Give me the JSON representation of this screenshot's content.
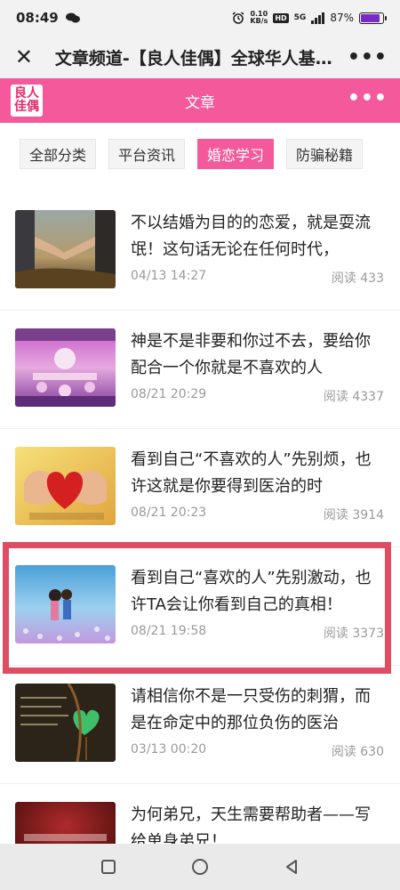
{
  "status": {
    "time": "08:49",
    "net_speed_top": "0.10",
    "net_speed_bottom": "KB/s",
    "hd": "HD",
    "network": "5G",
    "battery": "87%",
    "battery_level": 0.87
  },
  "titlebar": {
    "title": "文章频道-【良人佳偶】全球华人基…"
  },
  "header": {
    "logo_line1": "良人",
    "logo_line2": "佳偶",
    "title": "文章"
  },
  "tabs": [
    {
      "label": "全部分类"
    },
    {
      "label": "平台资讯"
    },
    {
      "label": "婚恋学习"
    },
    {
      "label": "防骗秘籍"
    }
  ],
  "articles": [
    {
      "title": "不以结婚为目的的恋爱，就是耍流氓！这句话无论在任何时代，",
      "date": "04/13 14:27",
      "reads": "阅读 433"
    },
    {
      "title": "神是不是非要和你过不去，要给你配合一个你就是不喜欢的人",
      "date": "08/21 20:29",
      "reads": "阅读 4337"
    },
    {
      "title": "看到自己“不喜欢的人”先别烦，也许这就是你要得到医治的时",
      "date": "08/21 20:23",
      "reads": "阅读 3914"
    },
    {
      "title": "看到自己“喜欢的人”先别激动，也许TA会让你看到自己的真相！",
      "date": "08/21 19:58",
      "reads": "阅读 3373"
    },
    {
      "title": "请相信你不是一只受伤的刺猬，而是在命定中的那位负伤的医治",
      "date": "03/13 00:20",
      "reads": "阅读 630"
    },
    {
      "title": "为何弟兄，天生需要帮助者——写给单身弟兄！",
      "date": "",
      "reads": ""
    }
  ],
  "colors": {
    "brand_pink": "#f4599b",
    "highlight_red": "#e04d63"
  }
}
